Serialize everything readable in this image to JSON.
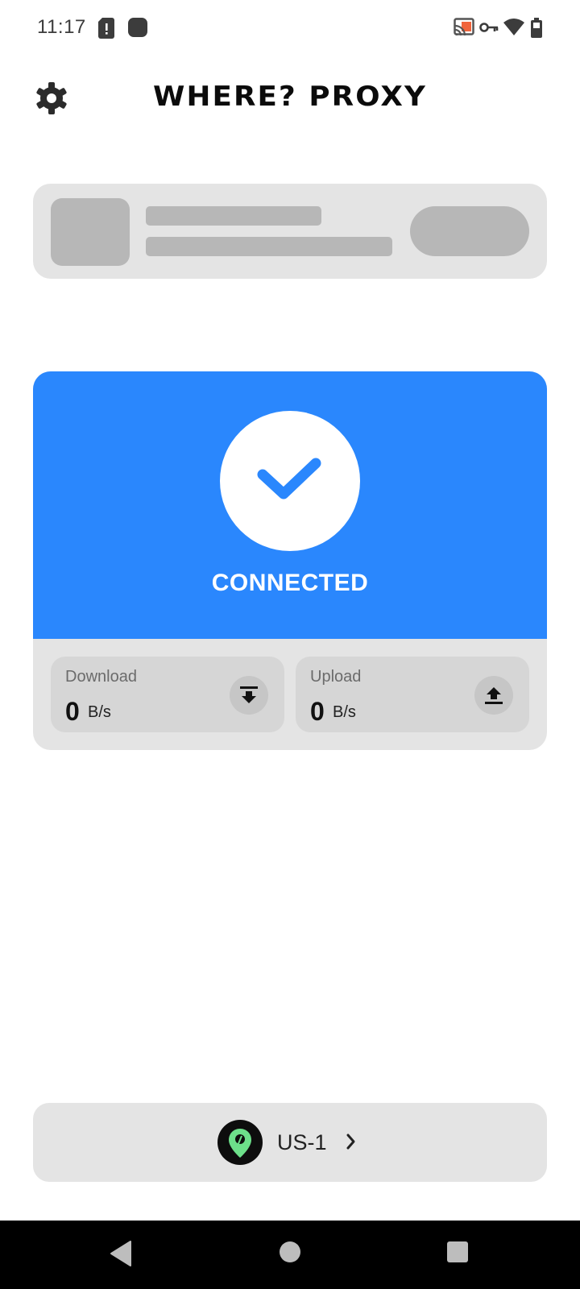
{
  "status_bar": {
    "time": "11:17",
    "icons": [
      "sim-alert-icon",
      "app-notification-icon",
      "cast-icon",
      "vpn-key-icon",
      "wifi-icon",
      "battery-icon"
    ]
  },
  "header": {
    "title": "WHERE? PROXY",
    "settings_icon": "gear-icon"
  },
  "connection": {
    "status": "CONNECTED",
    "accent_color": "#2a87fd",
    "download": {
      "label": "Download",
      "value": "0",
      "unit": "B/s"
    },
    "upload": {
      "label": "Upload",
      "value": "0",
      "unit": "B/s"
    }
  },
  "server": {
    "name": "US-1",
    "icon": "location-pin-icon"
  },
  "nav": {
    "buttons": [
      "back-icon",
      "home-icon",
      "recents-icon"
    ]
  }
}
